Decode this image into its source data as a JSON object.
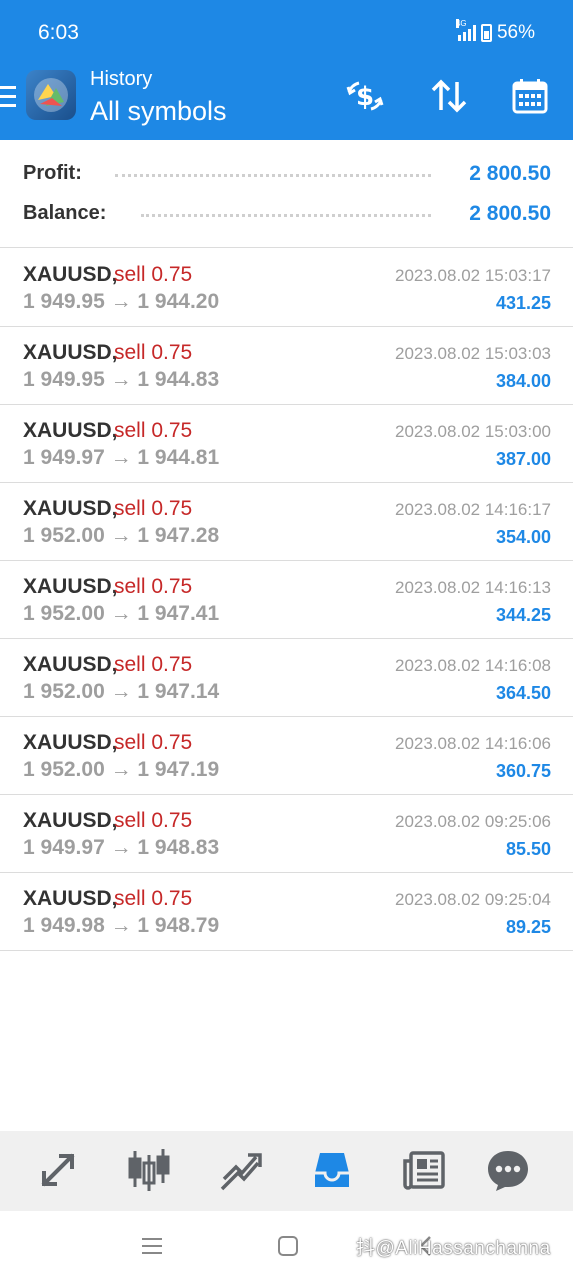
{
  "status_bar": {
    "time": "6:03",
    "network": "4G",
    "battery": "56%"
  },
  "app_bar": {
    "subtitle": "History",
    "title": "All symbols"
  },
  "icons": {
    "menu": "menu-icon",
    "logo": "metatrader-logo",
    "currency": "dollar-swap-icon",
    "sort": "sort-arrows-icon",
    "calendar": "calendar-icon"
  },
  "summary": {
    "profit_label": "Profit:",
    "profit_value": "2 800.50",
    "balance_label": "Balance:",
    "balance_value": "2 800.50"
  },
  "deals": [
    {
      "symbol": "XAUUSD,",
      "side": "sell 0.75",
      "prices": "1 949.95 → 1 944.20",
      "time": "2023.08.02 15:03:17",
      "profit": "431.25"
    },
    {
      "symbol": "XAUUSD,",
      "side": "sell 0.75",
      "prices": "1 949.95 → 1 944.83",
      "time": "2023.08.02 15:03:03",
      "profit": "384.00"
    },
    {
      "symbol": "XAUUSD,",
      "side": "sell 0.75",
      "prices": "1 949.97 → 1 944.81",
      "time": "2023.08.02 15:03:00",
      "profit": "387.00"
    },
    {
      "symbol": "XAUUSD,",
      "side": "sell 0.75",
      "prices": "1 952.00 → 1 947.28",
      "time": "2023.08.02 14:16:17",
      "profit": "354.00"
    },
    {
      "symbol": "XAUUSD,",
      "side": "sell 0.75",
      "prices": "1 952.00 → 1 947.41",
      "time": "2023.08.02 14:16:13",
      "profit": "344.25"
    },
    {
      "symbol": "XAUUSD,",
      "side": "sell 0.75",
      "prices": "1 952.00 → 1 947.14",
      "time": "2023.08.02 14:16:08",
      "profit": "364.50"
    },
    {
      "symbol": "XAUUSD,",
      "side": "sell 0.75",
      "prices": "1 952.00 → 1 947.19",
      "time": "2023.08.02 14:16:06",
      "profit": "360.75"
    },
    {
      "symbol": "XAUUSD,",
      "side": "sell 0.75",
      "prices": "1 949.97 → 1 948.83",
      "time": "2023.08.02 09:25:06",
      "profit": "85.50"
    },
    {
      "symbol": "XAUUSD,",
      "side": "sell 0.75",
      "prices": "1 949.98 → 1 948.79",
      "time": "2023.08.02 09:25:04",
      "profit": "89.25"
    }
  ],
  "bottom_nav": [
    {
      "name": "quotes-icon"
    },
    {
      "name": "chart-icon"
    },
    {
      "name": "trade-icon"
    },
    {
      "name": "history-icon",
      "active": true
    },
    {
      "name": "news-icon"
    },
    {
      "name": "messages-icon"
    }
  ],
  "system_nav": {
    "watermark": "抖@AliHassanchanna"
  },
  "colors": {
    "primary": "#1e88e5",
    "sell": "#c62828",
    "muted": "#9e9e9e",
    "text": "#333333",
    "nav_bg": "#f0f0f0"
  }
}
